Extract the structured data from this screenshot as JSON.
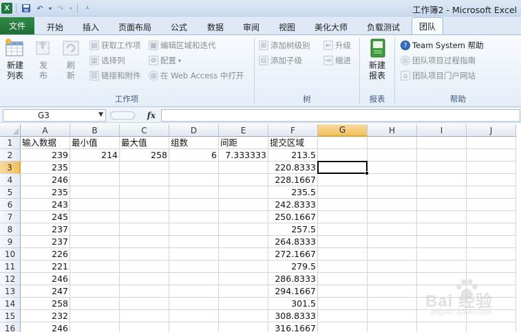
{
  "window": {
    "title": "工作簿2 - Microsoft Excel"
  },
  "file_tab": "文件",
  "tabs": [
    "开始",
    "插入",
    "页面布局",
    "公式",
    "数据",
    "审阅",
    "视图",
    "美化大师",
    "负载测试",
    "团队"
  ],
  "active_tab": "团队",
  "ribbon": {
    "work_items": {
      "label": "工作项",
      "new_list": "新建\n列表",
      "publish": "发\n布",
      "refresh": "刷\n新",
      "get_work_items": "获取工作项",
      "choose_columns": "选择列",
      "links_attachments": "链接和附件",
      "edit_areas": "编辑区域和迭代",
      "configure": "配置",
      "open_web_access": "在 Web Access 中打开"
    },
    "tree": {
      "label": "树",
      "add_tree_level": "添加树级别",
      "add_child": "添加子级",
      "promote": "升级",
      "demote": "缩进"
    },
    "reports": {
      "label": "报表",
      "new_report": "新建\n报表"
    },
    "help": {
      "label": "帮助",
      "team_system_help": "Team System 帮助",
      "process_guidance": "团队项目过程指南",
      "portal": "团队项目门户网站"
    }
  },
  "formula_bar": {
    "name_box": "G3",
    "fx": "fx",
    "formula": ""
  },
  "columns": [
    "A",
    "B",
    "C",
    "D",
    "E",
    "F",
    "G",
    "H",
    "I",
    "J"
  ],
  "selected_cell": {
    "col": "G",
    "row": "3"
  },
  "rows": [
    {
      "n": "1",
      "cells": [
        "输入数据",
        "最小值",
        "最大值",
        "组数",
        "间距",
        "提交区域",
        "",
        "",
        "",
        ""
      ]
    },
    {
      "n": "2",
      "cells": [
        "239",
        "214",
        "258",
        "6",
        "7.333333",
        "213.5",
        "",
        "",
        "",
        ""
      ]
    },
    {
      "n": "3",
      "cells": [
        "235",
        "",
        "",
        "",
        "",
        "220.8333",
        "",
        "",
        "",
        ""
      ]
    },
    {
      "n": "4",
      "cells": [
        "246",
        "",
        "",
        "",
        "",
        "228.1667",
        "",
        "",
        "",
        ""
      ]
    },
    {
      "n": "5",
      "cells": [
        "235",
        "",
        "",
        "",
        "",
        "235.5",
        "",
        "",
        "",
        ""
      ]
    },
    {
      "n": "6",
      "cells": [
        "243",
        "",
        "",
        "",
        "",
        "242.8333",
        "",
        "",
        "",
        ""
      ]
    },
    {
      "n": "7",
      "cells": [
        "245",
        "",
        "",
        "",
        "",
        "250.1667",
        "",
        "",
        "",
        ""
      ]
    },
    {
      "n": "8",
      "cells": [
        "237",
        "",
        "",
        "",
        "",
        "257.5",
        "",
        "",
        "",
        ""
      ]
    },
    {
      "n": "9",
      "cells": [
        "237",
        "",
        "",
        "",
        "",
        "264.8333",
        "",
        "",
        "",
        ""
      ]
    },
    {
      "n": "10",
      "cells": [
        "226",
        "",
        "",
        "",
        "",
        "272.1667",
        "",
        "",
        "",
        ""
      ]
    },
    {
      "n": "11",
      "cells": [
        "221",
        "",
        "",
        "",
        "",
        "279.5",
        "",
        "",
        "",
        ""
      ]
    },
    {
      "n": "12",
      "cells": [
        "246",
        "",
        "",
        "",
        "",
        "286.8333",
        "",
        "",
        "",
        ""
      ]
    },
    {
      "n": "13",
      "cells": [
        "247",
        "",
        "",
        "",
        "",
        "294.1667",
        "",
        "",
        "",
        ""
      ]
    },
    {
      "n": "14",
      "cells": [
        "258",
        "",
        "",
        "",
        "",
        "301.5",
        "",
        "",
        "",
        ""
      ]
    },
    {
      "n": "15",
      "cells": [
        "232",
        "",
        "",
        "",
        "",
        "308.8333",
        "",
        "",
        "",
        ""
      ]
    },
    {
      "n": "16",
      "cells": [
        "246",
        "",
        "",
        "",
        "",
        "316.1667",
        "",
        "",
        "",
        ""
      ]
    }
  ],
  "watermark": {
    "text": "Bai 经验",
    "sub": "jingyan.baidu.com"
  }
}
